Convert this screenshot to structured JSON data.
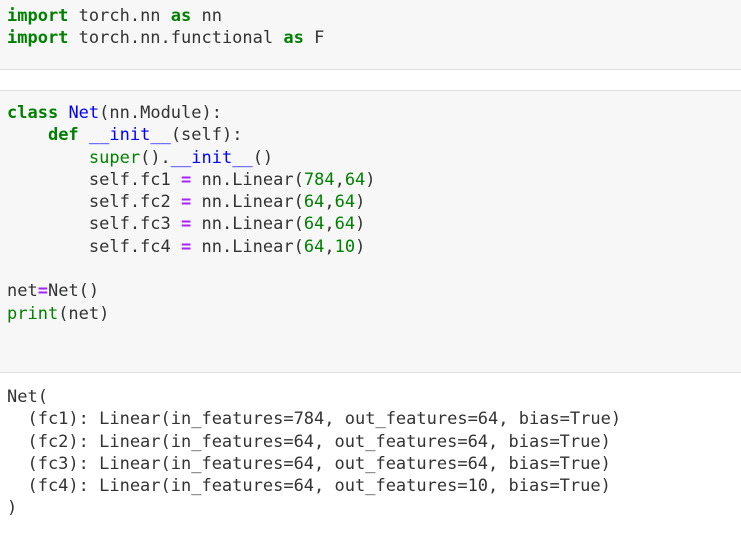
{
  "cells": [
    {
      "lines": [
        [
          {
            "t": "import",
            "c": "kw"
          },
          {
            "t": " torch.nn ",
            "c": "tx"
          },
          {
            "t": "as",
            "c": "kw"
          },
          {
            "t": " nn",
            "c": "tx"
          }
        ],
        [
          {
            "t": "import",
            "c": "kw"
          },
          {
            "t": " torch.nn.functional ",
            "c": "tx"
          },
          {
            "t": "as",
            "c": "kw"
          },
          {
            "t": " F",
            "c": "tx"
          }
        ]
      ]
    },
    {
      "lines": [
        [
          {
            "t": "class",
            "c": "kw"
          },
          {
            "t": " ",
            "c": "tx"
          },
          {
            "t": "Net",
            "c": "fn"
          },
          {
            "t": "(nn.Module):",
            "c": "tx"
          }
        ],
        [
          {
            "t": "    ",
            "c": "tx"
          },
          {
            "t": "def",
            "c": "kw"
          },
          {
            "t": " ",
            "c": "tx"
          },
          {
            "t": "__init__",
            "c": "fn"
          },
          {
            "t": "(self):",
            "c": "tx"
          }
        ],
        [
          {
            "t": "        ",
            "c": "tx"
          },
          {
            "t": "super",
            "c": "bi"
          },
          {
            "t": "().",
            "c": "tx"
          },
          {
            "t": "__init__",
            "c": "fn"
          },
          {
            "t": "()",
            "c": "tx"
          }
        ],
        [
          {
            "t": "        self.fc1 ",
            "c": "tx"
          },
          {
            "t": "=",
            "c": "op"
          },
          {
            "t": " nn.Linear(",
            "c": "tx"
          },
          {
            "t": "784",
            "c": "num"
          },
          {
            "t": ",",
            "c": "tx"
          },
          {
            "t": "64",
            "c": "num"
          },
          {
            "t": ")",
            "c": "tx"
          }
        ],
        [
          {
            "t": "        self.fc2 ",
            "c": "tx"
          },
          {
            "t": "=",
            "c": "op"
          },
          {
            "t": " nn.Linear(",
            "c": "tx"
          },
          {
            "t": "64",
            "c": "num"
          },
          {
            "t": ",",
            "c": "tx"
          },
          {
            "t": "64",
            "c": "num"
          },
          {
            "t": ")",
            "c": "tx"
          }
        ],
        [
          {
            "t": "        self.fc3 ",
            "c": "tx"
          },
          {
            "t": "=",
            "c": "op"
          },
          {
            "t": " nn.Linear(",
            "c": "tx"
          },
          {
            "t": "64",
            "c": "num"
          },
          {
            "t": ",",
            "c": "tx"
          },
          {
            "t": "64",
            "c": "num"
          },
          {
            "t": ")",
            "c": "tx"
          }
        ],
        [
          {
            "t": "        self.fc4 ",
            "c": "tx"
          },
          {
            "t": "=",
            "c": "op"
          },
          {
            "t": " nn.Linear(",
            "c": "tx"
          },
          {
            "t": "64",
            "c": "num"
          },
          {
            "t": ",",
            "c": "tx"
          },
          {
            "t": "10",
            "c": "num"
          },
          {
            "t": ")",
            "c": "tx"
          }
        ],
        [
          {
            "t": "",
            "c": "tx"
          }
        ],
        [
          {
            "t": "net",
            "c": "tx"
          },
          {
            "t": "=",
            "c": "op"
          },
          {
            "t": "Net()",
            "c": "tx"
          }
        ],
        [
          {
            "t": "print",
            "c": "bi"
          },
          {
            "t": "(net)",
            "c": "tx"
          }
        ]
      ]
    }
  ],
  "output": {
    "lines": [
      "Net(",
      "  (fc1): Linear(in_features=784, out_features=64, bias=True)",
      "  (fc2): Linear(in_features=64, out_features=64, bias=True)",
      "  (fc3): Linear(in_features=64, out_features=64, bias=True)",
      "  (fc4): Linear(in_features=64, out_features=10, bias=True)",
      ")"
    ]
  },
  "colors": {
    "keyword": "#008000",
    "function_name": "#0000ff",
    "number": "#008000",
    "operator": "#aa22ff",
    "cell_background": "#f7f7f7"
  }
}
